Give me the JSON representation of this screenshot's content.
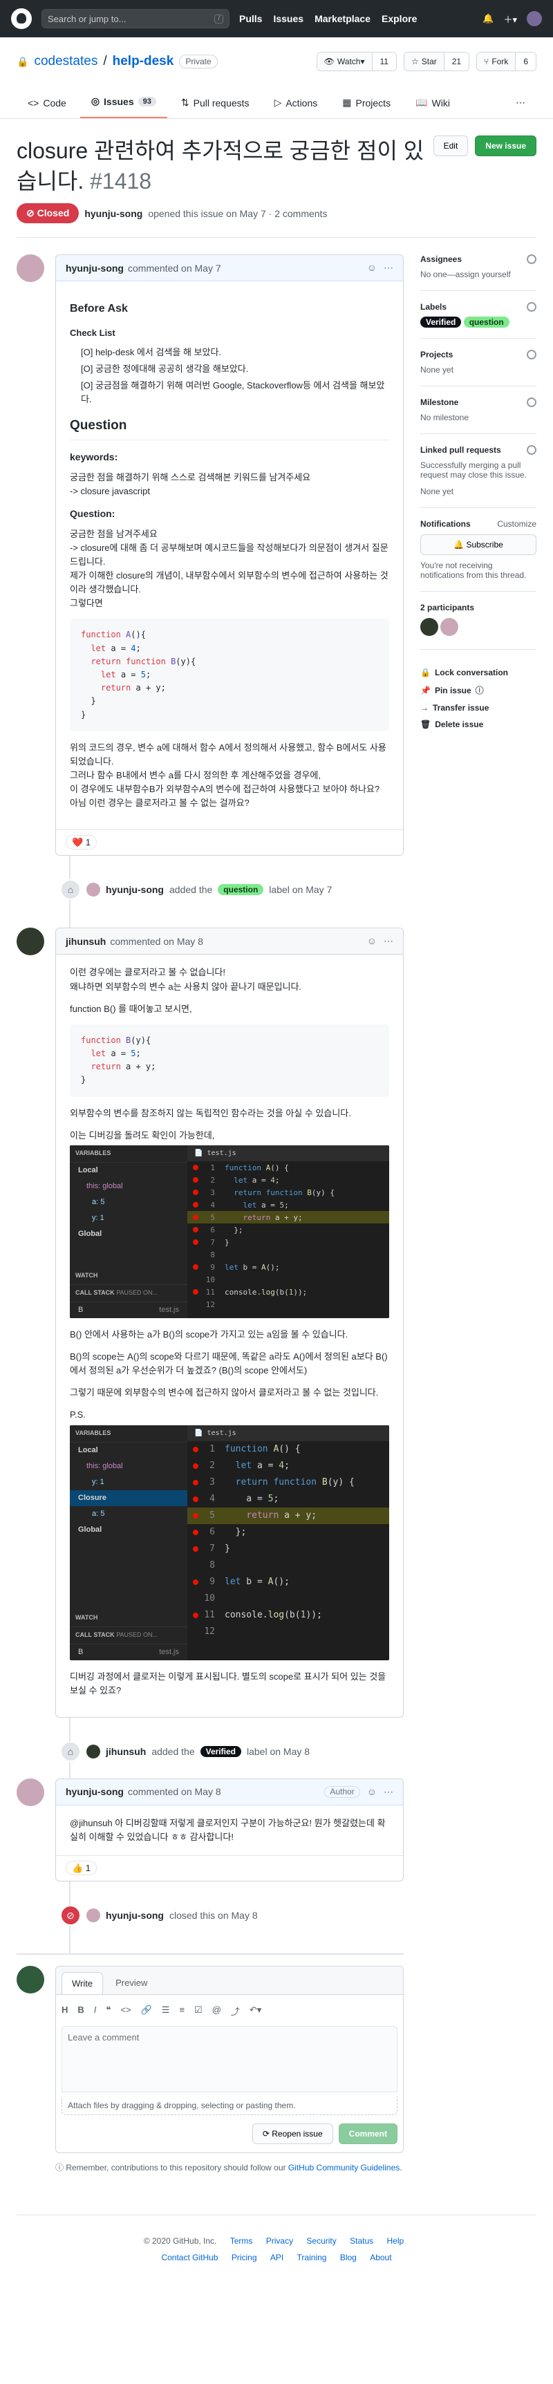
{
  "header": {
    "search_placeholder": "Search or jump to...",
    "search_key": "/",
    "nav": [
      "Pulls",
      "Issues",
      "Marketplace",
      "Explore"
    ]
  },
  "repo": {
    "owner": "codestates",
    "name": "help-desk",
    "visibility": "Private",
    "watch_label": "Watch",
    "watch_count": "11",
    "star_label": "Star",
    "star_count": "21",
    "fork_label": "Fork",
    "fork_count": "6"
  },
  "tabs": [
    {
      "label": "Code"
    },
    {
      "label": "Issues",
      "count": "93"
    },
    {
      "label": "Pull requests"
    },
    {
      "label": "Actions"
    },
    {
      "label": "Projects"
    },
    {
      "label": "Wiki"
    }
  ],
  "issue": {
    "title": "closure 관련하여 추가적으로 궁금한 점이 있습니다.",
    "number": "#1418",
    "edit_label": "Edit",
    "new_issue_label": "New issue",
    "state": "Closed",
    "author": "hyunju-song",
    "opened_text": "opened this issue on May 7 · 2 comments"
  },
  "comment1": {
    "author": "hyunju-song",
    "time": "commented on May 7",
    "h_before": "Before Ask",
    "h_checklist": "Check List",
    "checklist": [
      "[O] help-desk 에서 검색을 해 보았다.",
      "[O] 궁금한 정에대해 공공히 생각을 해보았다.",
      "[O] 궁금점을 해결하기 위해 여러번 Google, Stackoverflow등 에서 검색을 해보았다."
    ],
    "h_question": "Question",
    "keywords_label": "keywords:",
    "keywords_1": "궁금한 점을 해결하기 위해 스스로 검색해본 키워드를 남겨주세요",
    "keywords_2": "-> closure javascript",
    "question_label": "Question:",
    "q_1": "궁금한 점을 남겨주세요",
    "q_2": "-> closure에 대해 좀 더 공부해보며 예시코드들을 작성해보다가 의문점이 생겨서 질문드립니다.",
    "q_3": "제가 이해한 closure의 개념이, 내부함수에서 외부함수의 변수에 접근하여 사용하는 것이라 생각했습니다.",
    "q_4": "그렇다면",
    "after_1": "위의 코드의 경우, 변수 a에 대해서 함수 A에서 정의해서 사용했고, 함수 B에서도 사용되었습니다.",
    "after_2": "그러나 함수 B내에서 변수 a를 다시 정의한 후 계산해주었을 경우에,",
    "after_3": "이 경우에도 내부함수B가 외부함수A의 변수에 접근하여 사용했다고 보아야 하나요?",
    "after_4": "아님 이런 경우는 클로저라고 볼 수 없는 걸까요?",
    "reaction": "❤️ 1"
  },
  "event_label1": {
    "actor": "hyunju-song",
    "verb": "added the",
    "label": "question",
    "suffix": "label on May 7"
  },
  "comment2": {
    "author": "jihunsuh",
    "time": "commented on May 8",
    "p1": "이런 경우에는 클로저라고 볼 수 없습니다!",
    "p2": "왜냐하면 외부함수의 변수 a는 사용치 않아 끝나기 때문입니다.",
    "p3": "function B() 를 때어놓고 보시면,",
    "p4": "외부함수의 변수를 참조하지 않는 독립적인 함수라는 것을 아실 수 있습니다.",
    "p5": "이는 디버깅을 돌려도 확인이 가능한데,",
    "p6": "B() 안에서 사용하는 a가 B()의 scope가 가지고 있는 a임을 볼 수 있습니다.",
    "p7": "B()의 scope는 A()의 scope와 다르기 때문에, 똑같은 a라도 A()에서 정의된 a보다 B()에서 정의된 a가 우선순위가 더 높겠죠? (B()의 scope 안에서도)",
    "p8": "그렇기 때문에 외부함수의 변수에 접근하지 않아서 클로저라고 볼 수 없는 것입니다.",
    "ps": "P.S.",
    "p9": "디버깅 과정에서 클로저는 이렇게 표시됩니다. 별도의 scope로 표시가 되어 있는 것을 보실 수 있죠?"
  },
  "debugger": {
    "variables": "VARIABLES",
    "local": "Local",
    "this_label": "this: global",
    "a_label": "a: 5",
    "y_label": "y: 1",
    "global": "Global",
    "closure": "Closure",
    "closure_a": "a: 5",
    "watch": "WATCH",
    "callstack": "CALL STACK",
    "paused": "PAUSED ON...",
    "frame": "B",
    "frame_file": "test.js",
    "file_tab": "test.js"
  },
  "event_label2": {
    "actor": "jihunsuh",
    "verb": "added the",
    "label": "Verified",
    "suffix": "label on May 8"
  },
  "comment3": {
    "author": "hyunju-song",
    "time": "commented on May 8",
    "role": "Author",
    "body": "@jihunsuh 아 디버깅할때 저렇게 클로저인지 구분이 가능하군요! 뭔가 헷갈렸는데 확실히 이해할 수 있었습니다 ㅎㅎ 감사합니다!",
    "reaction": "👍 1"
  },
  "event_closed": {
    "actor": "hyunju-song",
    "text": "closed this on May 8"
  },
  "composer": {
    "tab_write": "Write",
    "tab_preview": "Preview",
    "placeholder": "Leave a comment",
    "attach": "Attach files by dragging & dropping, selecting or pasting them.",
    "reopen": "Reopen issue",
    "comment": "Comment",
    "note_prefix": "Remember, contributions to this repository should follow our",
    "note_link": "GitHub Community Guidelines."
  },
  "sidebar": {
    "assignees": "Assignees",
    "assignees_none": "No one—assign yourself",
    "labels": "Labels",
    "label_verified": "Verified",
    "label_question": "question",
    "projects": "Projects",
    "projects_none": "None yet",
    "milestone": "Milestone",
    "milestone_none": "No milestone",
    "linked": "Linked pull requests",
    "linked_desc": "Successfully merging a pull request may close this issue.",
    "linked_none": "None yet",
    "notifications": "Notifications",
    "customize": "Customize",
    "subscribe": "Subscribe",
    "notif_desc": "You're not receiving notifications from this thread.",
    "participants": "2 participants",
    "lock": "Lock conversation",
    "pin": "Pin issue",
    "transfer": "Transfer issue",
    "delete": "Delete issue"
  },
  "footer": {
    "copyright": "© 2020 GitHub, Inc.",
    "links": [
      "Terms",
      "Privacy",
      "Security",
      "Status",
      "Help",
      "Contact GitHub",
      "Pricing",
      "API",
      "Training",
      "Blog",
      "About"
    ]
  },
  "colors": {
    "accent": "#0366d6",
    "closed": "#d73a49",
    "green": "#2ea44f",
    "question": "#7ee98c"
  }
}
